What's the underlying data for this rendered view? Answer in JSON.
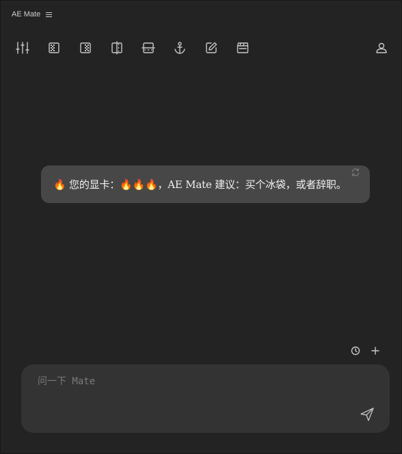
{
  "app": {
    "title": "AE Mate",
    "menu_icon": "hamburger-menu-icon"
  },
  "toolbar": {
    "items": [
      {
        "icon": "sliders-icon"
      },
      {
        "icon": "transparency-grid-left-icon"
      },
      {
        "icon": "transparency-grid-right-icon"
      },
      {
        "icon": "split-vertical-icon"
      },
      {
        "icon": "split-horizontal-icon"
      },
      {
        "icon": "anchor-icon"
      },
      {
        "icon": "edit-icon"
      },
      {
        "icon": "clapperboard-icon"
      }
    ],
    "user_icon": "user-icon"
  },
  "message": {
    "text": "🔥 您的显卡：🔥🔥🔥，AE Mate 建议：买个冰袋，或者辞职。",
    "refresh_icon": "refresh-icon"
  },
  "chat_actions": {
    "history_icon": "clock-icon",
    "add_icon": "plus-icon"
  },
  "composer": {
    "placeholder": "问一下 Mate",
    "value": "",
    "send_icon": "send-icon"
  },
  "colors": {
    "background": "#232323",
    "bubble": "#474747",
    "input": "#333333",
    "icon": "#c9c9c9"
  }
}
